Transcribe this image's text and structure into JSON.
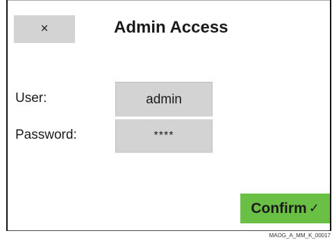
{
  "dialog": {
    "title": "Admin Access",
    "close_label": "×",
    "confirm_label": "Confirm",
    "confirm_icon": "✓"
  },
  "form": {
    "user_label": "User:",
    "user_value": "admin",
    "password_label": "Password:",
    "password_value": "****"
  },
  "footer": {
    "code": "MAOG_A_MM_K_00017"
  },
  "colors": {
    "confirm_button": "#6abf45",
    "field_background": "#d3d3d3",
    "close_button": "#d3d3d3"
  }
}
